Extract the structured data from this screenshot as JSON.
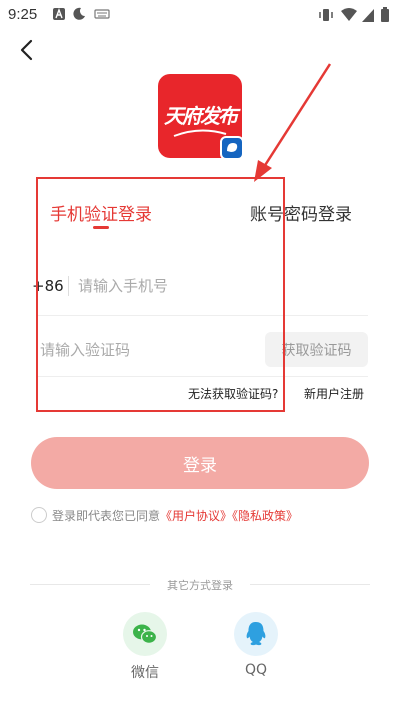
{
  "status_bar": {
    "time": "9:25"
  },
  "logo": {
    "text": "天府发布"
  },
  "tabs": [
    {
      "label": "手机验证登录",
      "active": true
    },
    {
      "label": "账号密码登录",
      "active": false
    }
  ],
  "phone": {
    "country_code": "+86",
    "placeholder": "请输入手机号"
  },
  "code": {
    "placeholder": "请输入验证码",
    "get_code_label": "获取验证码"
  },
  "links": {
    "cant_get_code": "无法获取验证码?",
    "register": "新用户注册"
  },
  "login_label": "登录",
  "agreement": {
    "prefix": "登录即代表您已同意",
    "user_agreement": "《用户协议》",
    "privacy_policy": "《隐私政策》"
  },
  "other_login": {
    "title": "其它方式登录",
    "wechat_label": "微信",
    "qq_label": "QQ"
  },
  "colors": {
    "accent": "#e53935",
    "login_button": "#f3aaa5",
    "logo_bg": "#e8262b"
  }
}
